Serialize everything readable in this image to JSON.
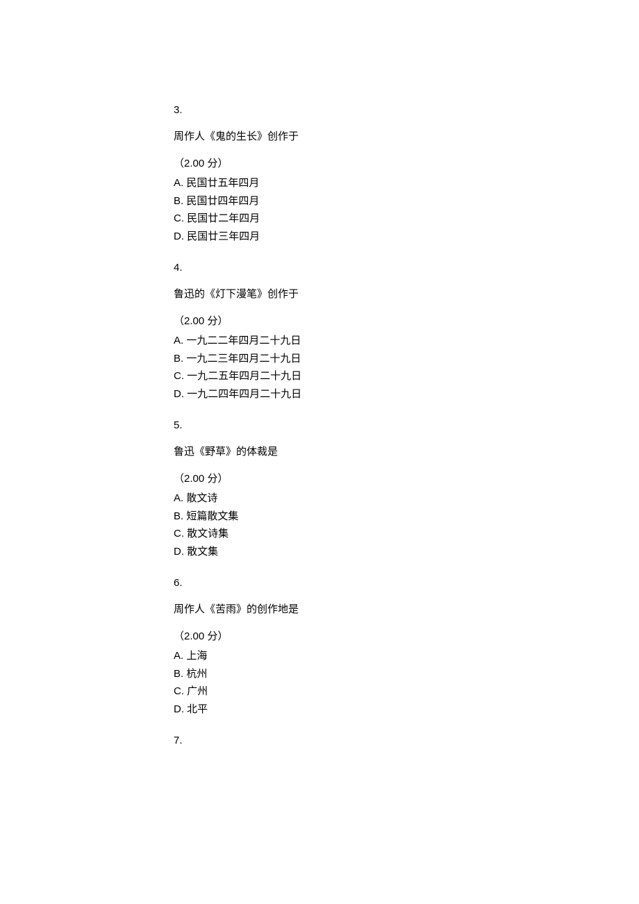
{
  "questions": [
    {
      "number": "3.",
      "stem": "周作人《鬼的生长》创作于",
      "points": "（2.00 分）",
      "options": [
        {
          "letter": "A.",
          "text": "民国廿五年四月"
        },
        {
          "letter": "B.",
          "text": "民国廿四年四月"
        },
        {
          "letter": "C.",
          "text": "民国廿二年四月"
        },
        {
          "letter": "D.",
          "text": "民国廿三年四月"
        }
      ]
    },
    {
      "number": "4.",
      "stem": "鲁迅的《灯下漫笔》创作于",
      "points": "（2.00 分）",
      "options": [
        {
          "letter": "A.",
          "text": "一九二二年四月二十九日"
        },
        {
          "letter": "B.",
          "text": "一九二三年四月二十九日"
        },
        {
          "letter": "C.",
          "text": "一九二五年四月二十九日"
        },
        {
          "letter": "D.",
          "text": "一九二四年四月二十九日"
        }
      ]
    },
    {
      "number": "5.",
      "stem": "鲁迅《野草》的体裁是",
      "points": "（2.00 分）",
      "options": [
        {
          "letter": "A.",
          "text": "散文诗"
        },
        {
          "letter": "B.",
          "text": "短篇散文集"
        },
        {
          "letter": "C.",
          "text": "散文诗集"
        },
        {
          "letter": "D.",
          "text": "散文集"
        }
      ]
    },
    {
      "number": "6.",
      "stem": "周作人《苦雨》的创作地是",
      "points": "（2.00 分）",
      "options": [
        {
          "letter": "A.",
          "text": "上海"
        },
        {
          "letter": "B.",
          "text": "杭州"
        },
        {
          "letter": "C.",
          "text": "广州"
        },
        {
          "letter": "D.",
          "text": "北平"
        }
      ]
    },
    {
      "number": "7.",
      "stem": "",
      "points": "",
      "options": []
    }
  ]
}
